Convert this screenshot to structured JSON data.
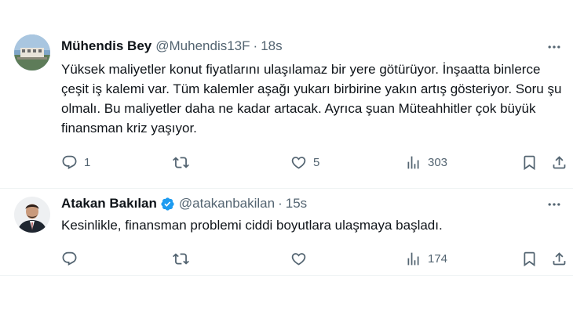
{
  "tweets": [
    {
      "display_name": "Mühendis Bey",
      "handle": "@Muhendis13F",
      "separator": "·",
      "time": "18s",
      "verified": false,
      "text": "Yüksek maliyetler konut fiyatlarını ulaşılamaz bir yere götürüyor. İnşaatta binlerce çeşit iş kalemi var. Tüm kalemler aşağı yukarı birbirine yakın artış gösteriyor. Soru şu olmalı. Bu maliyetler daha ne kadar artacak. Ayrıca şuan Müteahhitler çok büyük finansman kriz yaşıyor.",
      "replies": "1",
      "retweets": "",
      "likes": "5",
      "views": "303"
    },
    {
      "display_name": "Atakan Bakılan",
      "handle": "@atakanbakilan",
      "separator": "·",
      "time": "15s",
      "verified": true,
      "text": "Kesinlikle, finansman problemi ciddi boyutlara ulaşmaya başladı.",
      "replies": "",
      "retweets": "",
      "likes": "",
      "views": "174"
    }
  ],
  "icons": {
    "reply": "reply-icon",
    "retweet": "retweet-icon",
    "like": "like-icon",
    "views": "views-icon",
    "bookmark": "bookmark-icon",
    "share": "share-icon",
    "more": "more-icon",
    "verified": "verified-badge-icon"
  },
  "colors": {
    "text": "#0f1419",
    "secondary": "#536471",
    "verified": "#1d9bf0",
    "divider": "#eff3f4"
  }
}
